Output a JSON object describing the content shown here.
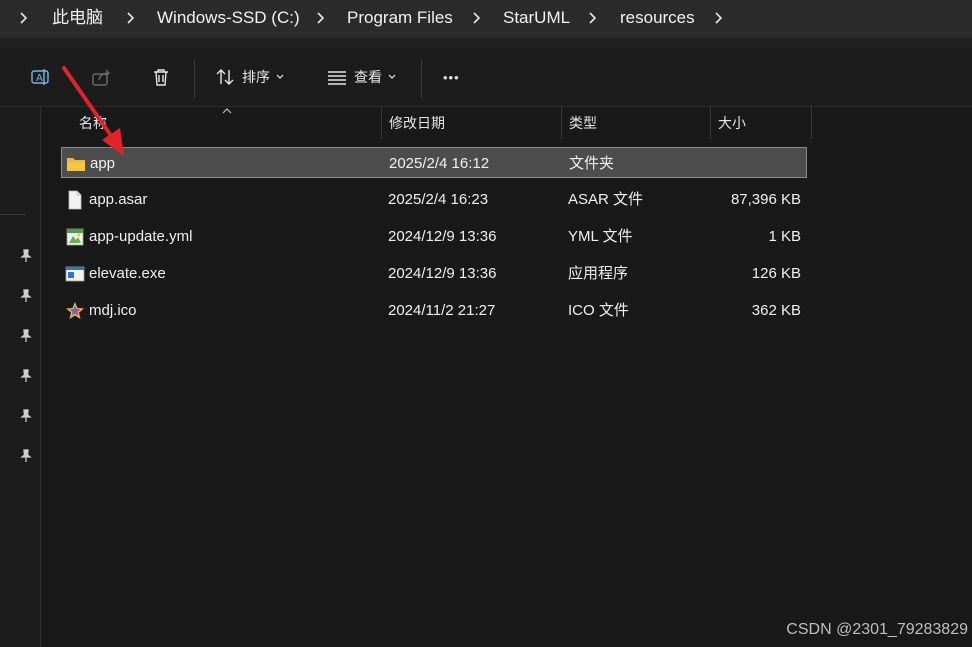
{
  "breadcrumb": {
    "items": [
      "此电脑",
      "Windows-SSD (C:)",
      "Program Files",
      "StarUML",
      "resources"
    ]
  },
  "toolbar": {
    "sort_label": "排序",
    "view_label": "查看",
    "more_label": "•••"
  },
  "columns": {
    "name": "名称",
    "modified": "修改日期",
    "type": "类型",
    "size": "大小"
  },
  "files": [
    {
      "name": "app",
      "modified": "2025/2/4 16:12",
      "type": "文件夹",
      "size": "",
      "icon": "folder-icon",
      "selected": true
    },
    {
      "name": "app.asar",
      "modified": "2025/2/4 16:23",
      "type": "ASAR 文件",
      "size": "87,396 KB",
      "icon": "file-icon",
      "selected": false
    },
    {
      "name": "app-update.yml",
      "modified": "2024/12/9 13:36",
      "type": "YML 文件",
      "size": "1 KB",
      "icon": "yml-file-icon",
      "selected": false
    },
    {
      "name": "elevate.exe",
      "modified": "2024/12/9 13:36",
      "type": "应用程序",
      "size": "126 KB",
      "icon": "exe-icon",
      "selected": false
    },
    {
      "name": "mdj.ico",
      "modified": "2024/11/2 21:27",
      "type": "ICO 文件",
      "size": "362 KB",
      "icon": "ico-file-icon",
      "selected": false
    }
  ],
  "watermark": "CSDN @2301_79283829",
  "colors": {
    "background": "#191919",
    "breadcrumb_bar": "#2b2b2b",
    "selection": "#4d4d4d",
    "folder": "#f4c542",
    "arrow": "#e0242a"
  }
}
